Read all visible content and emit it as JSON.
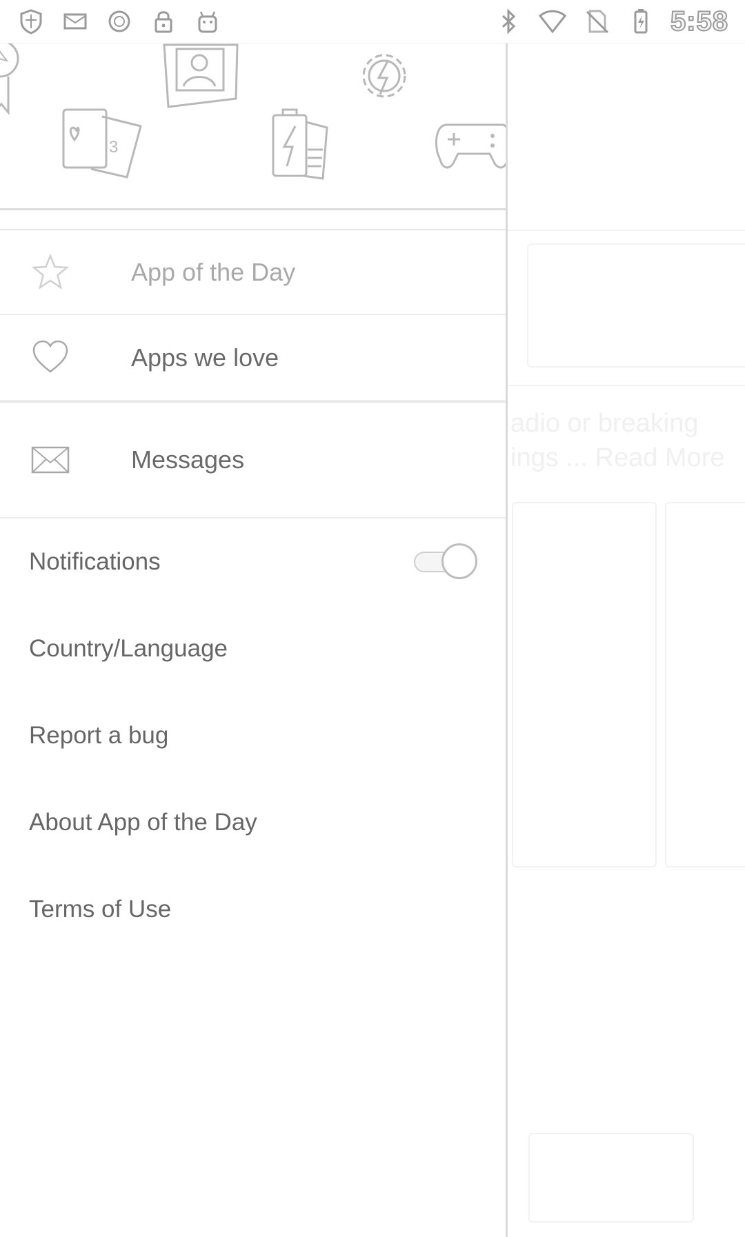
{
  "status_bar": {
    "time": "5:58",
    "left_icons": [
      "shield-icon",
      "mail-icon",
      "circle-icon",
      "lock-icon",
      "android-icon"
    ],
    "right_icons": [
      "bluetooth-icon",
      "wifi-icon",
      "no-sim-icon",
      "battery-charging-icon"
    ]
  },
  "drawer": {
    "header_icons": [
      "award-ribbon-icon",
      "photo-frame-icon",
      "settings-gear-icon",
      "cards-icon",
      "battery-icon",
      "gamepad-icon"
    ],
    "menu": [
      {
        "label": "App of the Day",
        "icon": "star-icon"
      },
      {
        "label": "Apps we love",
        "icon": "heart-icon"
      },
      {
        "label": "Messages",
        "icon": "envelope-icon"
      }
    ],
    "settings": {
      "notifications": {
        "label": "Notifications",
        "toggle_on": true
      },
      "country_language": "Country/Language",
      "report_bug": "Report a bug",
      "about": "About App of the Day",
      "terms": "Terms of Use"
    }
  },
  "background_app": {
    "text_line_1": "adio or breaking",
    "text_line_2": "ings ... Read More"
  },
  "colors": {
    "divider": "#ececec",
    "text": "#666666",
    "dim_text": "#a9a9a9",
    "icon_stroke": "#b8b8b8"
  }
}
